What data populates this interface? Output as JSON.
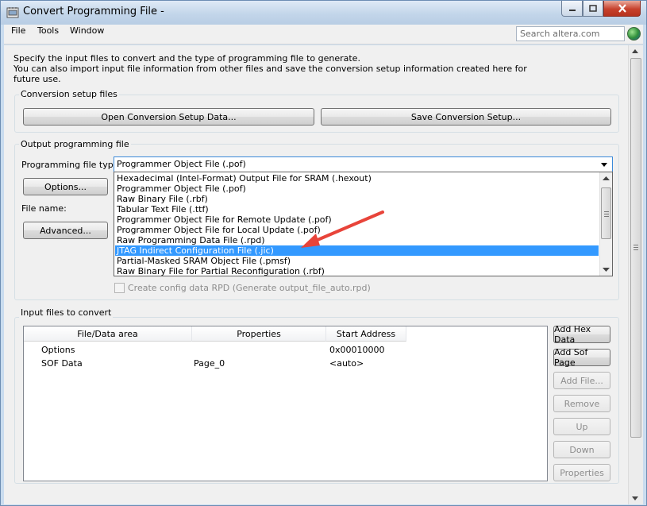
{
  "window": {
    "title": "Convert Programming File -"
  },
  "menubar": {
    "items": [
      "File",
      "Tools",
      "Window"
    ],
    "search_placeholder": "Search altera.com"
  },
  "intro": {
    "lines": [
      "Specify the input files to convert and the type of programming file to generate.",
      "You can also import input file information from other files and save the conversion setup information created here for",
      "future use."
    ]
  },
  "conversion_setup": {
    "label": "Conversion setup files",
    "open_button": "Open Conversion Setup Data...",
    "save_button": "Save Conversion Setup..."
  },
  "output": {
    "label": "Output programming file",
    "type_label": "Programming file type:",
    "selected_type": "Programmer Object File (.pof)",
    "options_button": "Options...",
    "file_name_label": "File name:",
    "advanced_button": "Advanced...",
    "create_rpd_label": "Create config data RPD (Generate output_file_auto.rpd)",
    "dropdown_options": [
      "Hexadecimal (Intel-Format) Output File for SRAM (.hexout)",
      "Programmer Object File (.pof)",
      "Raw Binary File (.rbf)",
      "Tabular Text File (.ttf)",
      "Programmer Object File for Remote Update (.pof)",
      "Programmer Object File for Local Update (.pof)",
      "Raw Programming Data File (.rpd)",
      "JTAG Indirect Configuration File (.jic)",
      "Partial-Masked SRAM Object File (.pmsf)",
      "Raw Binary File for Partial Reconfiguration (.rbf)"
    ],
    "highlighted_option": "JTAG Indirect Configuration File (.jic)"
  },
  "input_files": {
    "label": "Input files to convert",
    "columns": [
      "File/Data area",
      "Properties",
      "Start Address"
    ],
    "rows": [
      {
        "area": "Options",
        "properties": "",
        "address": "0x00010000"
      },
      {
        "area": "SOF Data",
        "properties": "Page_0",
        "address": "<auto>"
      }
    ],
    "buttons": {
      "add_hex": "Add Hex Data",
      "add_sof": "Add Sof Page",
      "add_file": "Add File...",
      "remove": "Remove",
      "up": "Up",
      "down": "Down",
      "properties": "Properties"
    }
  },
  "colors": {
    "selection": "#3399ff",
    "annotation_arrow": "#e8443a"
  }
}
